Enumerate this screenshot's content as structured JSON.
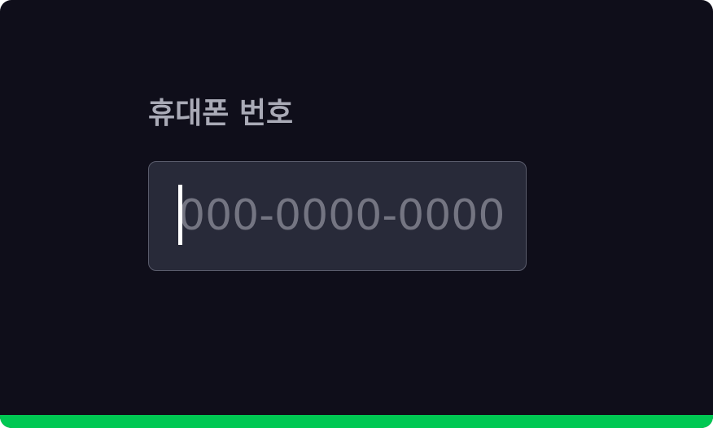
{
  "form": {
    "phone_label": "휴대폰 번호",
    "phone_value": "",
    "phone_placeholder": "000-0000-0000"
  },
  "theme": {
    "background": "#0f0e1a",
    "input_background": "#282a39",
    "input_border": "#5a5c6c",
    "label_color": "#a9aab6",
    "placeholder_color": "#747582",
    "accent": "#00c853"
  },
  "icons": {
    "caret": "text-cursor-icon"
  }
}
